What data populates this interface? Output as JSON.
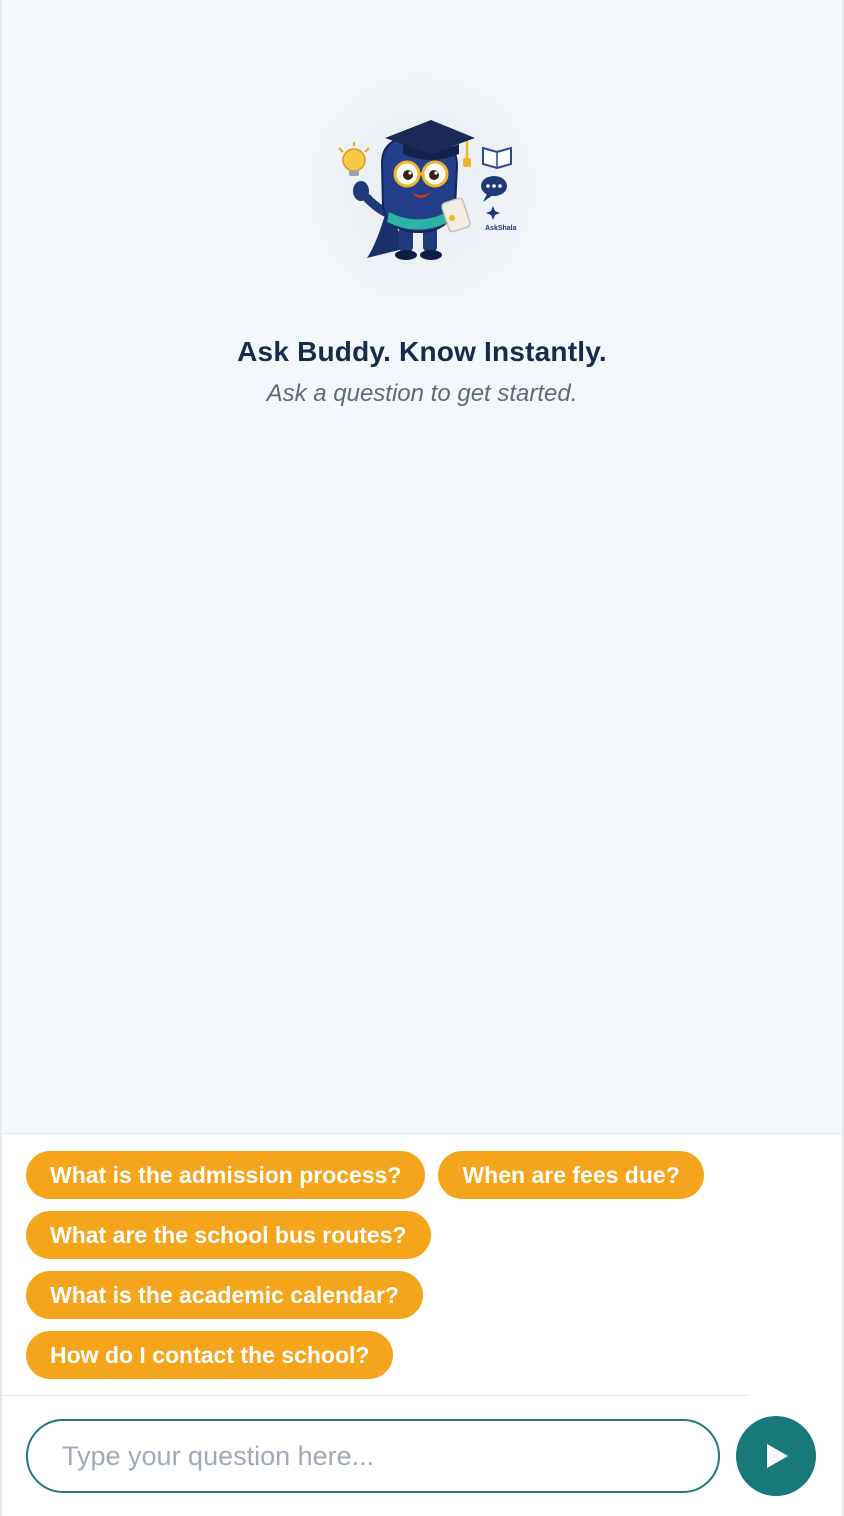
{
  "welcome": {
    "title": "Ask Buddy. Know Instantly.",
    "subtitle": "Ask a question to get started."
  },
  "mascot": {
    "icon": "graduate-mascot-icon",
    "badge_text": "AskShala"
  },
  "suggestions": [
    "What is the admission process?",
    "When are fees due?",
    "What are the school bus routes?",
    "What is the academic calendar?",
    "How do I contact the school?"
  ],
  "input": {
    "placeholder": "Type your question here...",
    "value": ""
  },
  "send_button": {
    "icon": "send-play-icon"
  },
  "colors": {
    "chip": "#f4a51b",
    "accent": "#177a78",
    "title": "#172b4d",
    "background": "#f4f7fb"
  }
}
